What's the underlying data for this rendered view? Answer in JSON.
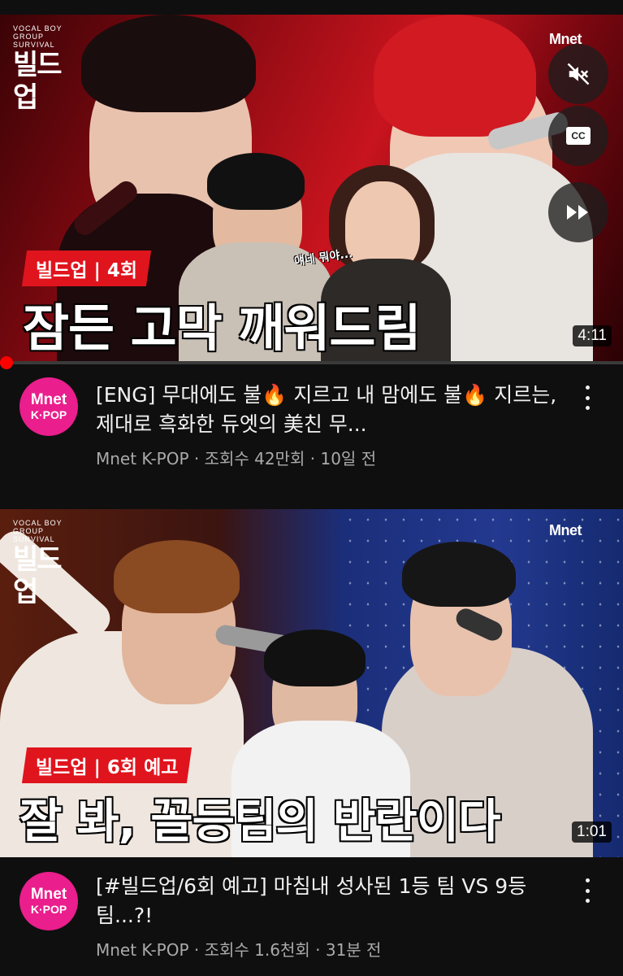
{
  "videos": [
    {
      "show_logo": "빌드업",
      "mnet_logo": "Mnet",
      "tag": "빌드업 | 4회",
      "headline": "잠든 고막 깨워드림",
      "caption": "얘네 뭐야...",
      "duration": "4:11",
      "progress_fraction": 0.008,
      "title": "[ENG] 무대에도 불🔥 지르고 내 맘에도 불🔥 지르는, 제대로 흑화한 듀엣의 美친 무...",
      "channel": "Mnet K-POP",
      "meta": "Mnet K-POP · 조회수 42만회 · 10일 전",
      "avatar_line1": "Mnet",
      "avatar_line2": "K·POP"
    },
    {
      "show_logo": "빌드업",
      "mnet_logo": "Mnet",
      "tag": "빌드업 | 6회 예고",
      "headline": "잘 봐, 꼴등팀의 반란이다",
      "duration": "1:01",
      "title": "[#빌드업/6회 예고] 마침내 성사된 1등 팀 VS 9등 팀...?!",
      "meta": "Mnet K-POP · 조회수 1.6천회 · 31분 전",
      "avatar_line1": "Mnet",
      "avatar_line2": "K·POP"
    }
  ],
  "player_controls": {
    "mute": "mute-icon",
    "captions": "CC",
    "skip": "fast-forward-icon"
  },
  "colors": {
    "background": "#0f0f0f",
    "progress": "#ff0000",
    "avatar": "#ea1e8c",
    "tag": "#e0141d"
  }
}
